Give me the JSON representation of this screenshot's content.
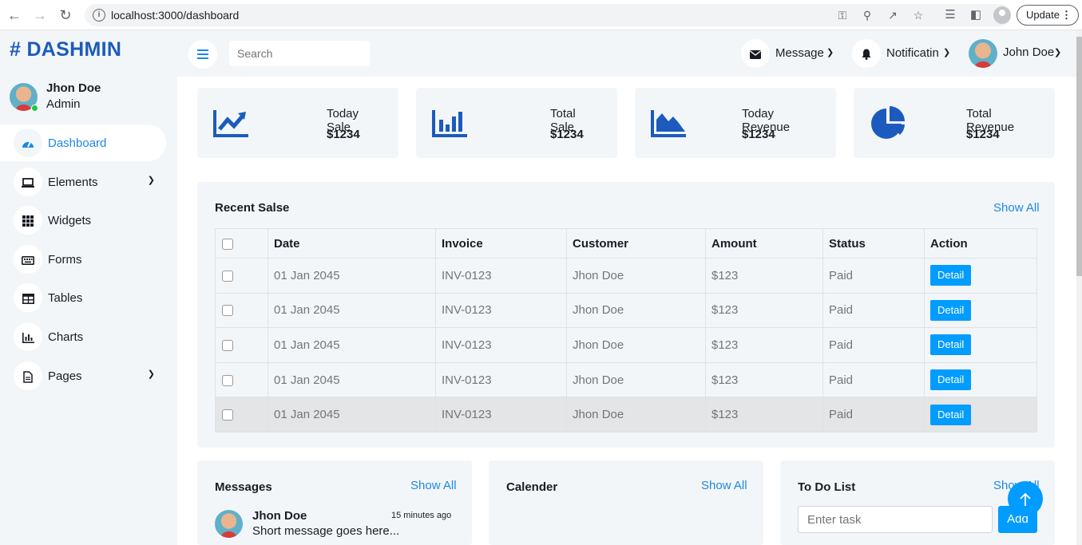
{
  "browser": {
    "url": "localhost:3000/dashboard",
    "update_label": "Update"
  },
  "brand": "# DASHMIN",
  "sidebar": {
    "user_name": "Jhon Doe",
    "user_role": "Admin",
    "items": [
      {
        "label": "Dashboard",
        "icon": "tachometer-icon",
        "active": true
      },
      {
        "label": "Elements",
        "icon": "laptop-icon",
        "has_dropdown": true
      },
      {
        "label": "Widgets",
        "icon": "grid-icon"
      },
      {
        "label": "Forms",
        "icon": "keyboard-icon"
      },
      {
        "label": "Tables",
        "icon": "table-icon"
      },
      {
        "label": "Charts",
        "icon": "chart-icon"
      },
      {
        "label": "Pages",
        "icon": "file-icon",
        "has_dropdown": true
      }
    ]
  },
  "topbar": {
    "search_placeholder": "Search",
    "message_label": "Message",
    "notification_label": "Notificatin",
    "user_label": "John Doe"
  },
  "stats": [
    {
      "label": "Today Sale",
      "value": "$1234",
      "icon": "chart-line-icon"
    },
    {
      "label": "Total Sale",
      "value": "$1234",
      "icon": "chart-bar-icon"
    },
    {
      "label": "Today Revenue",
      "value": "$1234",
      "icon": "chart-area-icon"
    },
    {
      "label": "Total Revenue",
      "value": "$1234",
      "icon": "chart-pie-icon"
    }
  ],
  "recent_sales": {
    "title": "Recent Salse",
    "show_all": "Show All",
    "columns": [
      "Date",
      "Invoice",
      "Customer",
      "Amount",
      "Status",
      "Action"
    ],
    "rows": [
      {
        "date": "01 Jan 2045",
        "invoice": "INV-0123",
        "customer": "Jhon Doe",
        "amount": "$123",
        "status": "Paid",
        "action": "Detail"
      },
      {
        "date": "01 Jan 2045",
        "invoice": "INV-0123",
        "customer": "Jhon Doe",
        "amount": "$123",
        "status": "Paid",
        "action": "Detail"
      },
      {
        "date": "01 Jan 2045",
        "invoice": "INV-0123",
        "customer": "Jhon Doe",
        "amount": "$123",
        "status": "Paid",
        "action": "Detail"
      },
      {
        "date": "01 Jan 2045",
        "invoice": "INV-0123",
        "customer": "Jhon Doe",
        "amount": "$123",
        "status": "Paid",
        "action": "Detail"
      },
      {
        "date": "01 Jan 2045",
        "invoice": "INV-0123",
        "customer": "Jhon Doe",
        "amount": "$123",
        "status": "Paid",
        "action": "Detail"
      }
    ]
  },
  "messages": {
    "title": "Messages",
    "show_all": "Show All",
    "items": [
      {
        "name": "Jhon Doe",
        "time": "15 minutes ago",
        "text": "Short message goes here..."
      }
    ]
  },
  "calendar": {
    "title": "Calender",
    "show_all": "Show All"
  },
  "todo": {
    "title": "To Do List",
    "show_all": "Show All",
    "input_placeholder": "Enter task",
    "add_label": "Add"
  },
  "colors": {
    "brand": "#1c5bbd",
    "accent": "#009cff",
    "link": "#1e88e5",
    "panel_bg": "#f3f6f9"
  }
}
